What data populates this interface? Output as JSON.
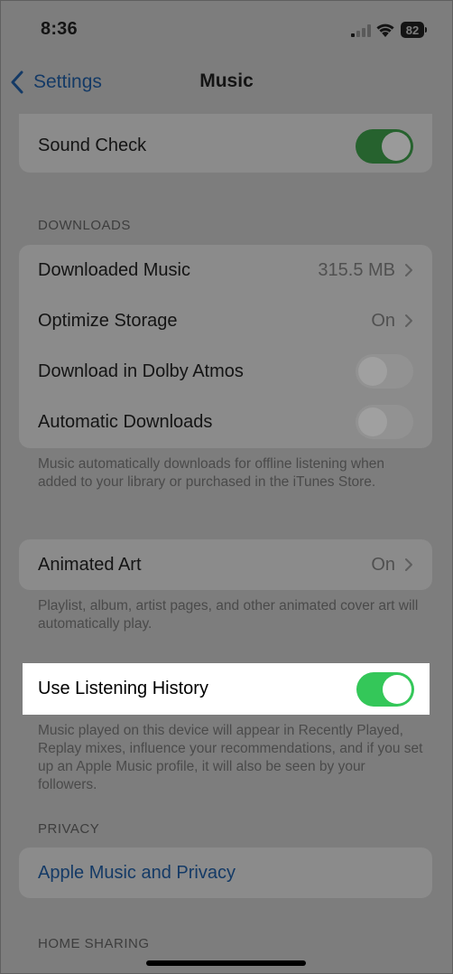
{
  "status_bar": {
    "time": "8:36",
    "battery": "82"
  },
  "nav": {
    "back_label": "Settings",
    "title": "Music"
  },
  "sound_check": {
    "label": "Sound Check",
    "state": "on"
  },
  "downloads": {
    "header": "DOWNLOADS",
    "rows": [
      {
        "label": "Downloaded Music",
        "value": "315.5 MB"
      },
      {
        "label": "Optimize Storage",
        "value": "On"
      },
      {
        "label": "Download in Dolby Atmos",
        "state": "off"
      },
      {
        "label": "Automatic Downloads",
        "state": "off"
      }
    ],
    "footer": "Music automatically downloads for offline listening when added to your library or purchased in the iTunes Store."
  },
  "animated_art": {
    "label": "Animated Art",
    "value": "On",
    "footer": "Playlist, album, artist pages, and other animated cover art will automatically play."
  },
  "listening_history": {
    "label": "Use Listening History",
    "state": "on",
    "footer": "Music played on this device will appear in Recently Played, Replay mixes, influence your recommendations, and if you set up an Apple Music profile, it will also be seen by your followers."
  },
  "privacy": {
    "header": "PRIVACY",
    "link": "Apple Music and Privacy"
  },
  "home_sharing": {
    "header": "HOME SHARING"
  },
  "colors": {
    "accent_blue": "#143a66",
    "toggle_on_dimmed": "#26622e",
    "toggle_on_bright": "#34c759",
    "highlight_bg": "#ffffff"
  }
}
